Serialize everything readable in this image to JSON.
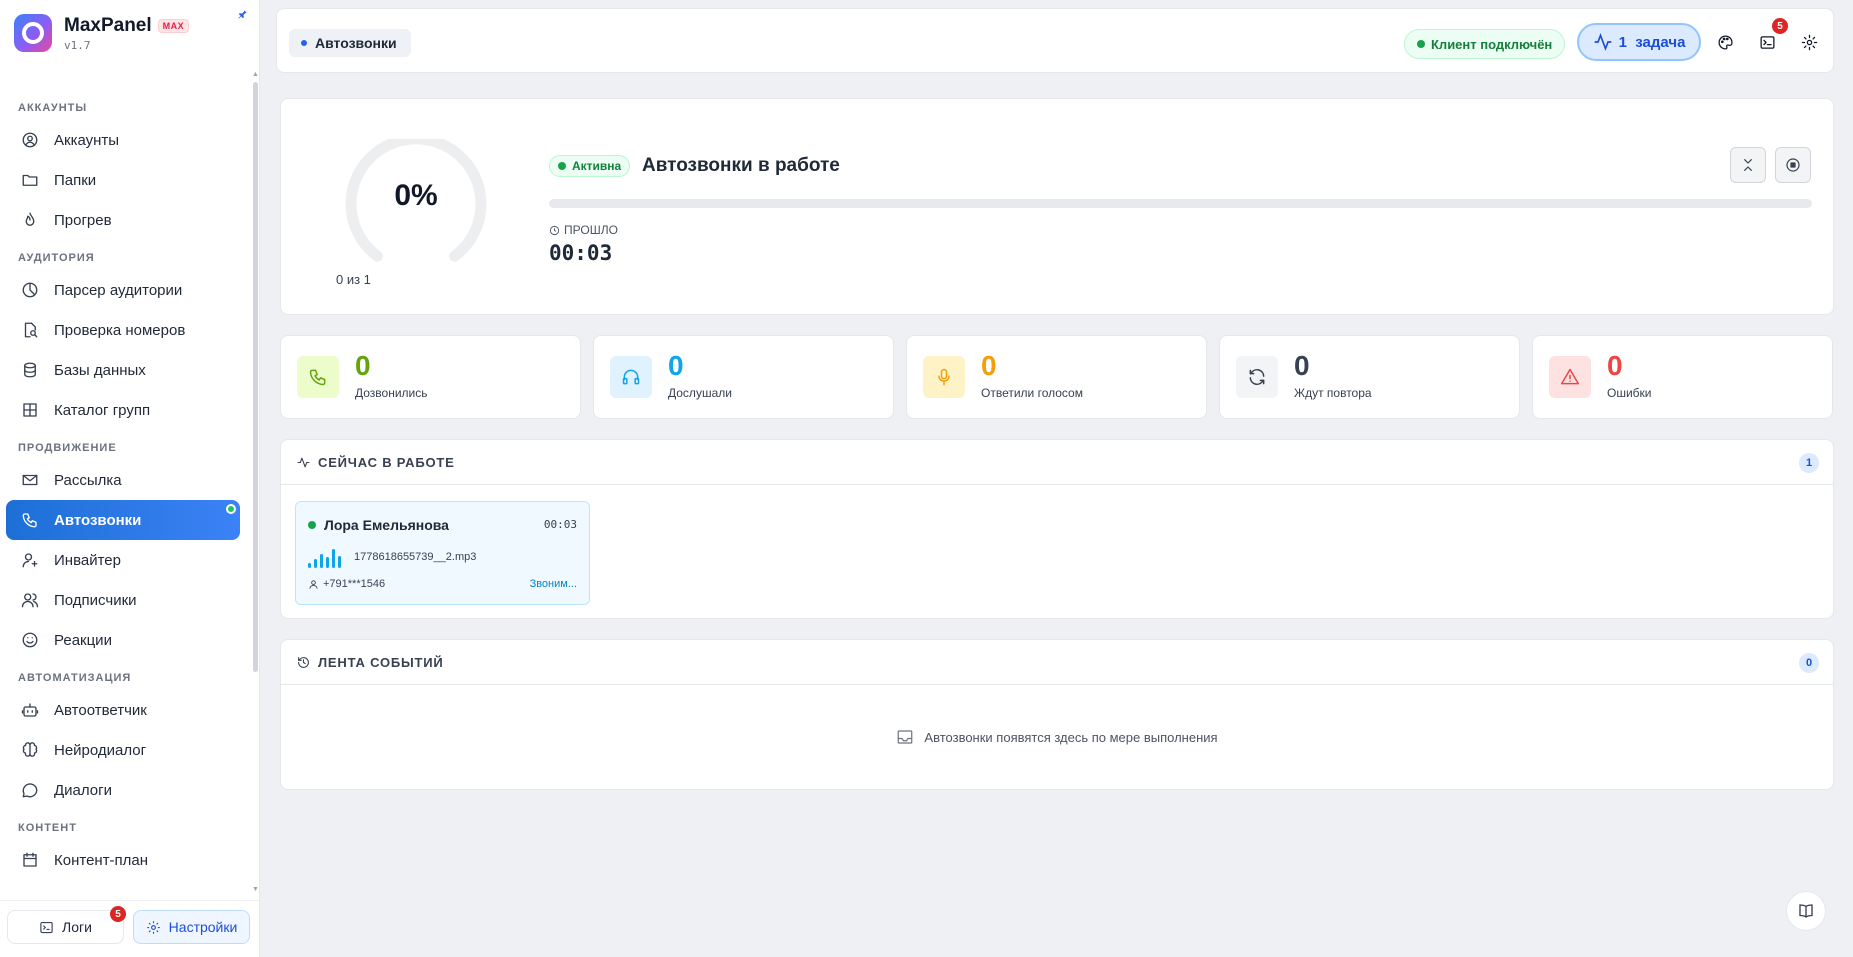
{
  "app": {
    "name": "MaxPanel",
    "badge": "MAX",
    "version": "v1.7"
  },
  "sidebar": {
    "sections": [
      {
        "title": "АККАУНТЫ",
        "items": [
          {
            "label": "Аккаунты",
            "icon": "user-circle-icon"
          },
          {
            "label": "Папки",
            "icon": "folder-icon"
          },
          {
            "label": "Прогрев",
            "icon": "flame-icon"
          }
        ]
      },
      {
        "title": "АУДИТОРИЯ",
        "items": [
          {
            "label": "Парсер аудитории",
            "icon": "pie-icon"
          },
          {
            "label": "Проверка номеров",
            "icon": "file-search-icon"
          },
          {
            "label": "Базы данных",
            "icon": "database-icon"
          },
          {
            "label": "Каталог групп",
            "icon": "grid-icon"
          }
        ]
      },
      {
        "title": "ПРОДВИЖЕНИЕ",
        "items": [
          {
            "label": "Рассылка",
            "icon": "mail-send-icon"
          },
          {
            "label": "Автозвонки",
            "icon": "phone-icon"
          },
          {
            "label": "Инвайтер",
            "icon": "user-plus-icon"
          },
          {
            "label": "Подписчики",
            "icon": "users-icon"
          },
          {
            "label": "Реакции",
            "icon": "smile-icon"
          }
        ]
      },
      {
        "title": "АВТОМАТИЗАЦИЯ",
        "items": [
          {
            "label": "Автоответчик",
            "icon": "bot-icon"
          },
          {
            "label": "Нейродиалог",
            "icon": "brain-icon"
          },
          {
            "label": "Диалоги",
            "icon": "chat-icon"
          }
        ]
      },
      {
        "title": "КОНТЕНТ",
        "items": [
          {
            "label": "Контент-план",
            "icon": "calendar-icon"
          }
        ]
      }
    ],
    "active": "Автозвонки",
    "footer": {
      "logs_label": "Логи",
      "logs_count": "5",
      "settings_label": "Настройки"
    }
  },
  "topbar": {
    "breadcrumb": "Автозвонки",
    "client_status": "Клиент подключён",
    "task_count": "1",
    "task_label": "задача",
    "console_badge": "5"
  },
  "progress": {
    "percent_text": "0%",
    "percent": 0,
    "counter": "0 из 1",
    "status_badge": "Активна",
    "title": "Автозвонки в работе",
    "elapsed_label": "ПРОШЛО",
    "elapsed_value": "00:03"
  },
  "stats": [
    {
      "value": "0",
      "label": "Дозвонились",
      "icon": "phone-icon",
      "color": "#65a30d",
      "bg": "#ecfccb"
    },
    {
      "value": "0",
      "label": "Дослушали",
      "icon": "headphones-icon",
      "color": "#0ea5e9",
      "bg": "#e0f2fe"
    },
    {
      "value": "0",
      "label": "Ответили голосом",
      "icon": "mic-icon",
      "color": "#f59e0b",
      "bg": "#fef3c7"
    },
    {
      "value": "0",
      "label": "Ждут повтора",
      "icon": "refresh-icon",
      "color": "#374151",
      "bg": "#f3f4f6"
    },
    {
      "value": "0",
      "label": "Ошибки",
      "icon": "warning-icon",
      "color": "#ef4444",
      "bg": "#fee2e2"
    }
  ],
  "in_progress": {
    "title": "СЕЙЧАС В РАБОТЕ",
    "count": "1",
    "calls": [
      {
        "name": "Лора Емельянова",
        "time": "00:03",
        "file": "1778618655739__2.mp3",
        "phone": "+791***1546",
        "status": "Звоним..."
      }
    ]
  },
  "events": {
    "title": "ЛЕНТА СОБЫТИЙ",
    "count": "0",
    "empty_text": "Автозвонки появятся здесь по мере выполнения"
  }
}
